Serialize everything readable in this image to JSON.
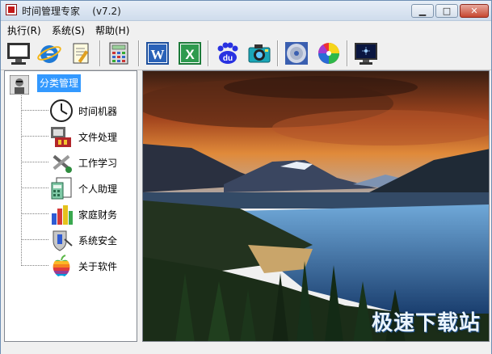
{
  "window": {
    "title": "时间管理专家    (v7.2)",
    "buttons": {
      "minimize": "▁",
      "maximize": "□",
      "close": "✕"
    }
  },
  "menu": [
    {
      "label": "执行(R)"
    },
    {
      "label": "系统(S)"
    },
    {
      "label": "帮助(H)"
    }
  ],
  "toolbar": [
    {
      "icon": "monitor-icon"
    },
    {
      "icon": "internet-explorer-icon"
    },
    {
      "icon": "notepad-icon"
    },
    {
      "icon": "calculator-icon"
    },
    {
      "icon": "word-icon",
      "text": "W"
    },
    {
      "icon": "excel-icon",
      "text": "X"
    },
    {
      "icon": "baidu-icon",
      "text": "du"
    },
    {
      "icon": "camera-icon"
    },
    {
      "icon": "cd-player-icon"
    },
    {
      "icon": "color-wheel-icon"
    },
    {
      "icon": "screensaver-icon"
    }
  ],
  "tree": {
    "root": "分类管理",
    "items": [
      {
        "label": "时间机器",
        "icon": "clock-icon"
      },
      {
        "label": "文件处理",
        "icon": "file-processing-icon"
      },
      {
        "label": "工作学习",
        "icon": "tools-icon"
      },
      {
        "label": "个人助理",
        "icon": "calculator-notepad-icon"
      },
      {
        "label": "家庭财务",
        "icon": "bar-chart-icon"
      },
      {
        "label": "系统安全",
        "icon": "shield-icon"
      },
      {
        "label": "关于软件",
        "icon": "apple-icon"
      }
    ]
  },
  "watermark": "极速下载站",
  "colors": {
    "selection": "#3399ff",
    "window_border": "#6d8fb4",
    "close": "#c6472f"
  }
}
